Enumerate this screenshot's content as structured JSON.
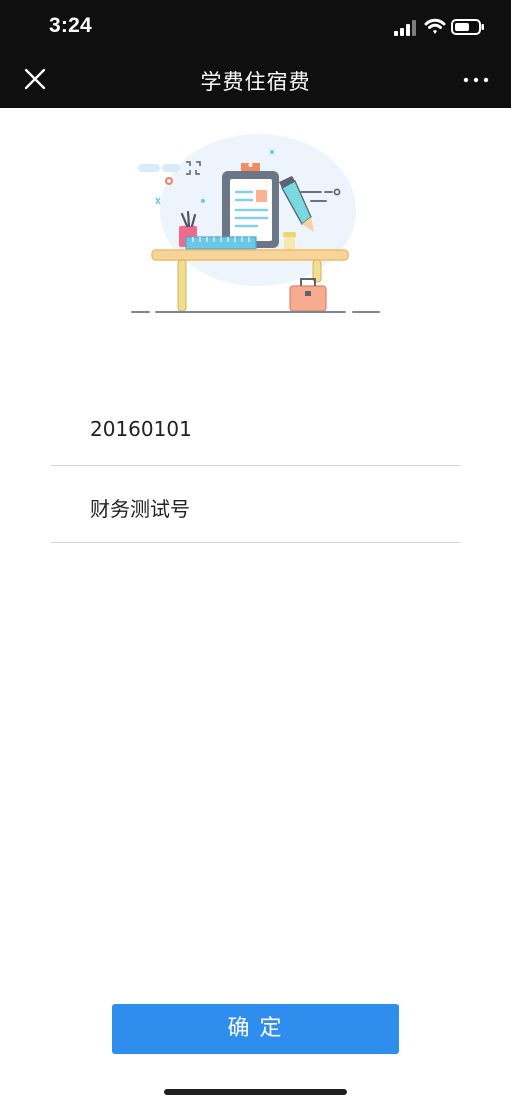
{
  "status_bar": {
    "time": "3:24"
  },
  "nav": {
    "title": "学费住宿费",
    "close_icon": "close-icon",
    "more_icon": "more-icon"
  },
  "form": {
    "fields": [
      {
        "value": "20160101"
      },
      {
        "value": "财务测试号"
      }
    ]
  },
  "actions": {
    "confirm_label": "确定"
  },
  "colors": {
    "topbar": "#0f0f10",
    "accent": "#2f8ded",
    "divider": "#d6d6d6"
  }
}
